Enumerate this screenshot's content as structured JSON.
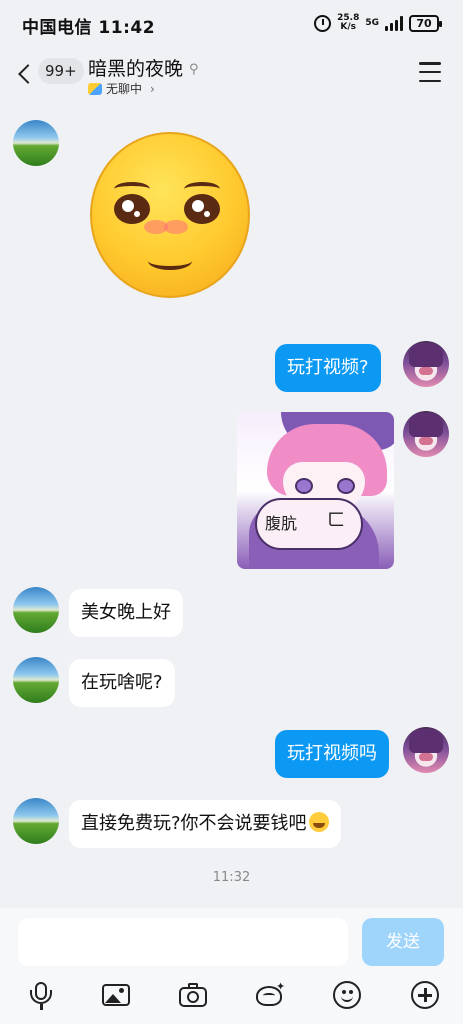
{
  "status_bar": {
    "carrier": "中国电信",
    "time": "11:42",
    "net_speed_value": "25.8",
    "net_speed_unit": "K/s",
    "network": "5G",
    "battery": "70"
  },
  "header": {
    "unread_count": "99+",
    "title": "暗黑的夜晚",
    "subtitle": "无聊中",
    "back_icon": "chevron-left-icon",
    "menu_icon": "hamburger-menu-icon"
  },
  "messages": [
    {
      "side": "other",
      "type": "emoji",
      "icon": "blushing-face-sticker"
    },
    {
      "side": "me",
      "type": "text",
      "text": "玩打视频?"
    },
    {
      "side": "me",
      "type": "image",
      "caption": "腹肮",
      "caption2": "ㄈ"
    },
    {
      "side": "other",
      "type": "text",
      "text": "美女晚上好"
    },
    {
      "side": "other",
      "type": "text",
      "text": "在玩啥呢?"
    },
    {
      "side": "me",
      "type": "text",
      "text": "玩打视频吗"
    },
    {
      "side": "other",
      "type": "text",
      "text": "直接免费玩?你不会说要钱吧"
    }
  ],
  "timestamp": "11:32",
  "input": {
    "value": "",
    "send_label": "发送"
  },
  "toolbar": [
    "mic-icon",
    "image-icon",
    "camera-icon",
    "red-packet-icon",
    "emoji-icon",
    "plus-icon"
  ],
  "colors": {
    "background": "#f0f1f5",
    "my_bubble": "#0c99f3",
    "other_bubble": "#ffffff",
    "send_button": "#9fd4fb"
  }
}
